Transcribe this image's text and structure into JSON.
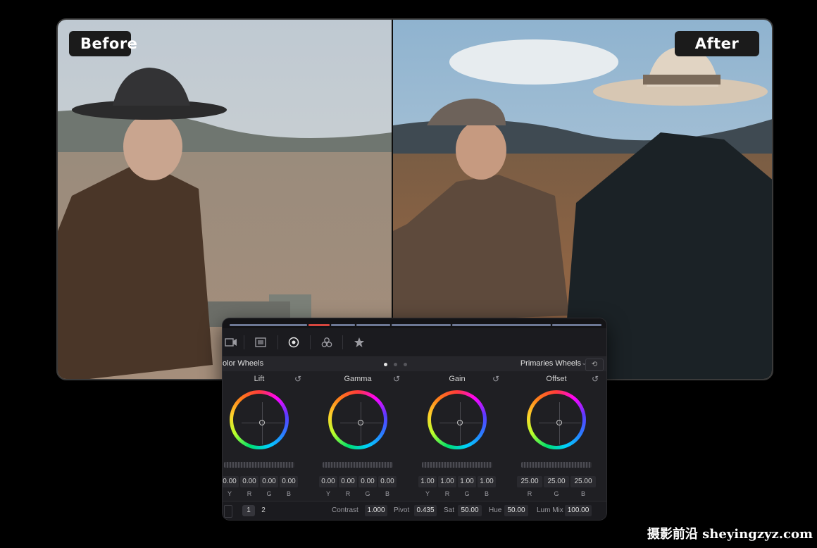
{
  "compare": {
    "before_label": "Before",
    "after_label": "After"
  },
  "panel": {
    "title": "olor Wheels",
    "mode": "Primaries Wheels",
    "wheels": [
      {
        "label": "Lift",
        "values": [
          "0.00",
          "0.00",
          "0.00",
          "0.00"
        ],
        "channels": [
          "Y",
          "R",
          "G",
          "B"
        ]
      },
      {
        "label": "Gamma",
        "values": [
          "0.00",
          "0.00",
          "0.00",
          "0.00"
        ],
        "channels": [
          "Y",
          "R",
          "G",
          "B"
        ]
      },
      {
        "label": "Gain",
        "values": [
          "1.00",
          "1.00",
          "1.00",
          "1.00"
        ],
        "channels": [
          "Y",
          "R",
          "G",
          "B"
        ]
      },
      {
        "label": "Offset",
        "values": [
          "25.00",
          "25.00",
          "25.00"
        ],
        "channels": [
          "R",
          "G",
          "B"
        ]
      }
    ],
    "footer": {
      "page_1": "1",
      "page_2": "2",
      "contrast_label": "Contrast",
      "contrast_value": "1.000",
      "pivot_label": "Pivot",
      "pivot_value": "0.435",
      "sat_label": "Sat",
      "sat_value": "50.00",
      "hue_label": "Hue",
      "hue_value": "50.00",
      "lummix_label": "Lum Mix",
      "lummix_value": "100.00"
    }
  },
  "watermark": "摄影前沿 sheyingzyz.com",
  "colors": {
    "accent_red": "#d6463e",
    "panel_bg": "#1f1f23"
  }
}
